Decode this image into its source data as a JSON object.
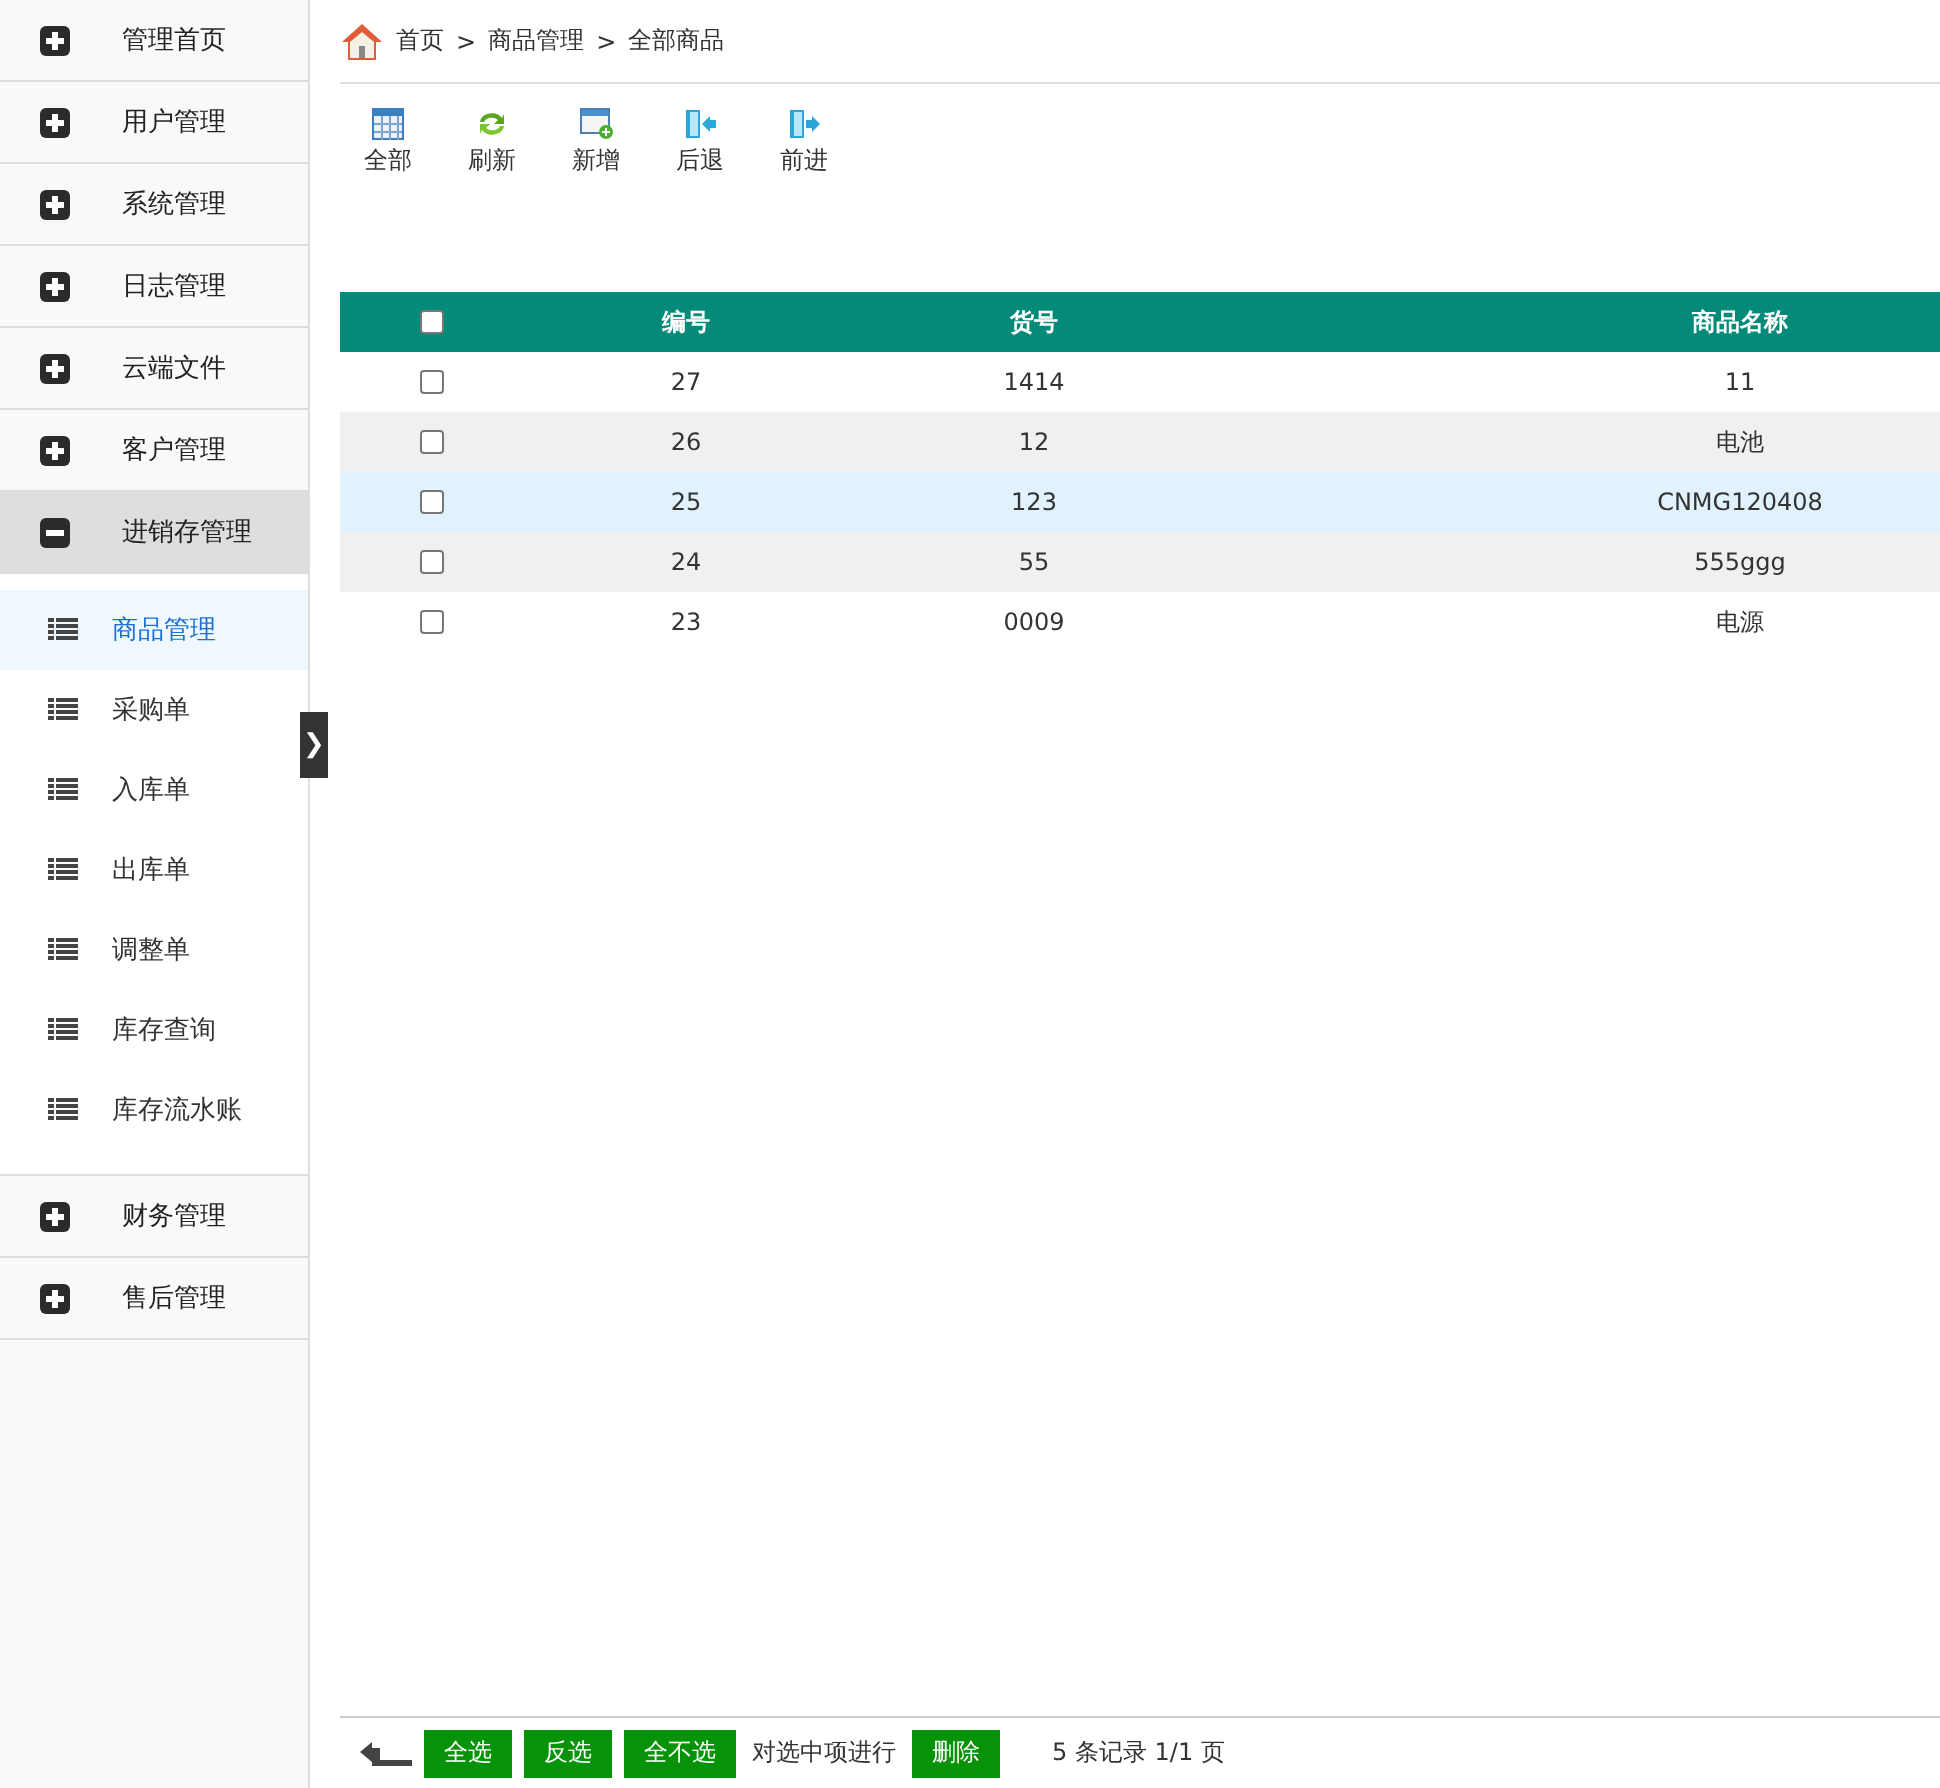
{
  "sidebar": {
    "groups": [
      {
        "label": "管理首页",
        "expanded": false
      },
      {
        "label": "用户管理",
        "expanded": false
      },
      {
        "label": "系统管理",
        "expanded": false
      },
      {
        "label": "日志管理",
        "expanded": false
      },
      {
        "label": "云端文件",
        "expanded": false
      },
      {
        "label": "客户管理",
        "expanded": false
      },
      {
        "label": "进销存管理",
        "expanded": true,
        "children": [
          {
            "label": "商品管理",
            "selected": true
          },
          {
            "label": "采购单",
            "selected": false
          },
          {
            "label": "入库单",
            "selected": false
          },
          {
            "label": "出库单",
            "selected": false
          },
          {
            "label": "调整单",
            "selected": false
          },
          {
            "label": "库存查询",
            "selected": false
          },
          {
            "label": "库存流水账",
            "selected": false
          }
        ]
      },
      {
        "label": "财务管理",
        "expanded": false
      },
      {
        "label": "售后管理",
        "expanded": false
      }
    ],
    "toggle": "❯"
  },
  "breadcrumb": [
    "首页",
    "商品管理",
    "全部商品"
  ],
  "breadcrumb_separator": ">",
  "toolbar": [
    {
      "kind": "grid",
      "label": "全部"
    },
    {
      "kind": "refresh",
      "label": "刷新"
    },
    {
      "kind": "add",
      "label": "新增"
    },
    {
      "kind": "back",
      "label": "后退"
    },
    {
      "kind": "forward",
      "label": "前进"
    }
  ],
  "table": {
    "header_checked": false,
    "columns": [
      "编号",
      "货号",
      "商品名称"
    ],
    "rows": [
      {
        "checked": false,
        "selected": false,
        "cells": [
          "27",
          "1414",
          "11"
        ]
      },
      {
        "checked": false,
        "selected": false,
        "cells": [
          "26",
          "12",
          "电池"
        ]
      },
      {
        "checked": false,
        "selected": true,
        "cells": [
          "25",
          "123",
          "CNMG120408"
        ]
      },
      {
        "checked": false,
        "selected": false,
        "cells": [
          "24",
          "55",
          "555ggg"
        ]
      },
      {
        "checked": false,
        "selected": false,
        "cells": [
          "23",
          "0009",
          "电源"
        ]
      }
    ]
  },
  "footer": {
    "buttons": [
      "全选",
      "反选",
      "全不选"
    ],
    "action_text": "对选中项进行",
    "action_button": "删除",
    "summary": "5 条记录 1/1 页"
  }
}
